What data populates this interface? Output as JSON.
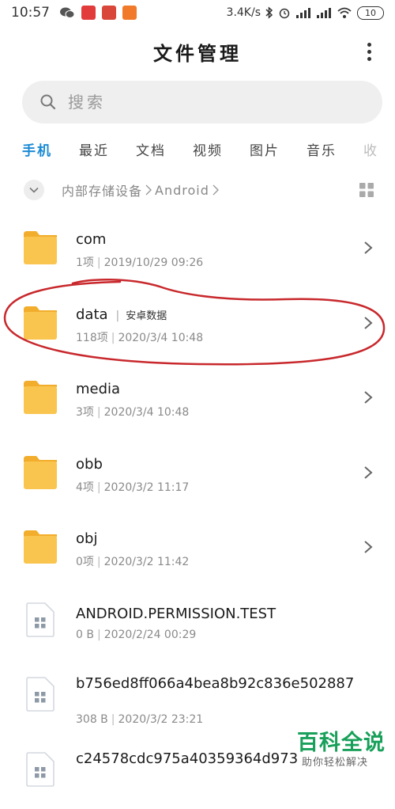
{
  "status_bar": {
    "time": "10:57",
    "net_speed": "3.4K/s",
    "battery": "10"
  },
  "header": {
    "title": "文件管理"
  },
  "search": {
    "placeholder": "搜索"
  },
  "tabs": [
    "手机",
    "最近",
    "文档",
    "视频",
    "图片",
    "音乐",
    "收"
  ],
  "breadcrumb": {
    "items": [
      "内部存储设备",
      "Android"
    ]
  },
  "files": [
    {
      "name": "com",
      "meta_count": "1项",
      "meta_time": "2019/10/29 09:26",
      "type": "folder"
    },
    {
      "name": "data",
      "tag": "安卓数据",
      "meta_count": "118项",
      "meta_time": "2020/3/4 10:48",
      "type": "folder"
    },
    {
      "name": "media",
      "meta_count": "3项",
      "meta_time": "2020/3/4 10:48",
      "type": "folder"
    },
    {
      "name": "obb",
      "meta_count": "4项",
      "meta_time": "2020/3/2 11:17",
      "type": "folder"
    },
    {
      "name": "obj",
      "meta_count": "0项",
      "meta_time": "2020/3/2 11:42",
      "type": "folder"
    },
    {
      "name": "ANDROID.PERMISSION.TEST",
      "meta_count": "0 B",
      "meta_time": "2020/2/24 00:29",
      "type": "file"
    },
    {
      "name": "b756ed8ff066a4bea8b92c836e502887",
      "meta_count": "308 B",
      "meta_time": "2020/3/2 23:21",
      "type": "file"
    },
    {
      "name": "c24578cdc975a40359364d973",
      "meta_count": "",
      "meta_time": "",
      "type": "file"
    }
  ],
  "colors": {
    "accent": "#1a8ad4",
    "folder": "#f9c54e",
    "folder_tab": "#f2ad2c",
    "annotation": "#c8282c",
    "watermark": "#18a05a"
  },
  "watermark": {
    "title": "百科全说",
    "subtitle": "助你轻松解决"
  }
}
